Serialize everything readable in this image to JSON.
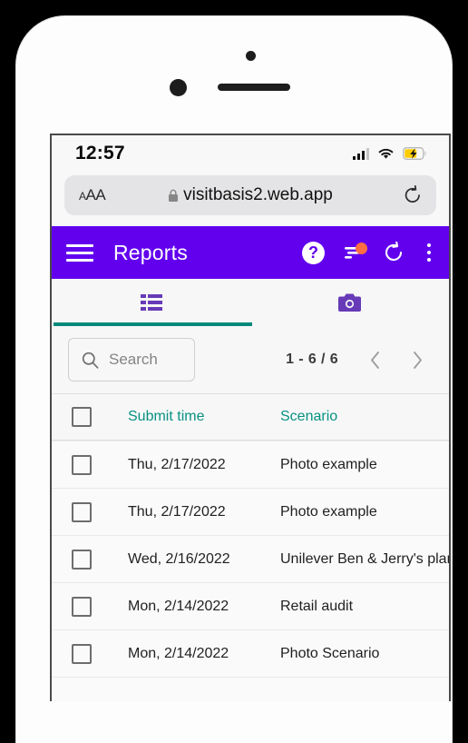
{
  "status_bar": {
    "time": "12:57",
    "signal_icon": "cellular-signal-icon",
    "wifi_icon": "wifi-icon",
    "battery_icon": "battery-charging-icon"
  },
  "browser": {
    "text_size_label": "AA",
    "lock_icon": "lock-icon",
    "url": "visitbasis2.web.app",
    "reload_icon": "reload-icon"
  },
  "app_bar": {
    "menu_icon": "hamburger-menu-icon",
    "title": "Reports",
    "help_label": "?",
    "help_icon": "help-circle-icon",
    "filter_icon": "filter-icon",
    "filter_badge": "",
    "refresh_icon": "refresh-icon",
    "overflow_icon": "overflow-menu-icon"
  },
  "tabs": [
    {
      "name": "list-tab",
      "icon": "list-view-icon",
      "active": true
    },
    {
      "name": "photo-tab",
      "icon": "camera-icon",
      "active": false
    }
  ],
  "toolbar": {
    "search_placeholder": "Search",
    "search_value": "",
    "search_icon": "search-icon",
    "pagination_range": "1 - 6 / 6",
    "prev_icon": "chevron-left-icon",
    "next_icon": "chevron-right-icon"
  },
  "table": {
    "columns": [
      {
        "key": "submit_time",
        "label": "Submit time"
      },
      {
        "key": "scenario",
        "label": "Scenario"
      }
    ],
    "rows": [
      {
        "submit_time": "Thu, 2/17/2022",
        "scenario": "Photo example"
      },
      {
        "submit_time": "Thu, 2/17/2022",
        "scenario": "Photo example"
      },
      {
        "submit_time": "Wed, 2/16/2022",
        "scenario": "Unilever  Ben & Jerry's planogra."
      },
      {
        "submit_time": "Mon, 2/14/2022",
        "scenario": "Retail audit"
      },
      {
        "submit_time": "Mon, 2/14/2022",
        "scenario": "Photo Scenario"
      },
      {
        "submit_time": "",
        "scenario": ""
      }
    ]
  },
  "colors": {
    "app_bar_purple": "#6200ee",
    "tab_indicator_teal": "#00897b",
    "header_label_teal": "#089183",
    "badge_orange": "#ff6e40",
    "icon_purple": "#673ab7",
    "battery_yellow": "#ffcc00"
  }
}
